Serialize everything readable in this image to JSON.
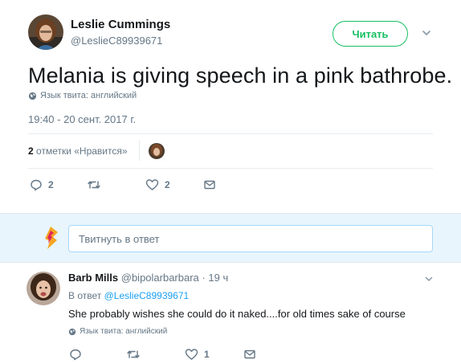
{
  "main_tweet": {
    "author_name": "Leslie Cummings",
    "author_handle": "@LeslieC89939671",
    "follow_label": "Читать",
    "text": "Melania is giving speech in a pink bathrobe.",
    "language_label": "Язык твита: английский",
    "timestamp": "19:40 - 20 сент. 2017 г.",
    "likes_count": "2",
    "likes_label": "отметки «Нравится»",
    "actions": {
      "replies": "2",
      "retweets": "",
      "likes": "2"
    }
  },
  "reply_box": {
    "placeholder": "Твитнуть в ответ"
  },
  "reply_tweet": {
    "author_name": "Barb Mills",
    "author_handle": "@bipolarbarbara",
    "separator": "·",
    "time": "19 ч",
    "reply_to_prefix": "В ответ",
    "reply_to_handle": "@LeslieC89939671",
    "text": "She probably wishes she could do it naked....for old times sake of course",
    "language_label": "Язык твита: английский",
    "actions": {
      "replies": "",
      "retweets": "",
      "likes": "1"
    }
  },
  "colors": {
    "follow_green": "#17bf63",
    "link_blue": "#1da1f2",
    "muted_gray": "#657786",
    "reply_bg": "#e8f5fd"
  }
}
